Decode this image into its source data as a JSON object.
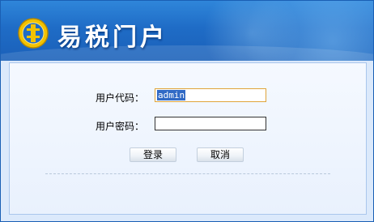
{
  "header": {
    "title": "易税门户",
    "logo_icon": "tax-emblem-icon"
  },
  "login": {
    "username_label": "用户代码：",
    "username_value": "admin",
    "password_label": "用户密码：",
    "password_value": ""
  },
  "buttons": {
    "login_label": "登录",
    "cancel_label": "取消"
  },
  "colors": {
    "banner": "#1f6cc6",
    "panel": "#eef4fd",
    "selection": "#316ac5",
    "focus_border": "#e0a43a"
  }
}
